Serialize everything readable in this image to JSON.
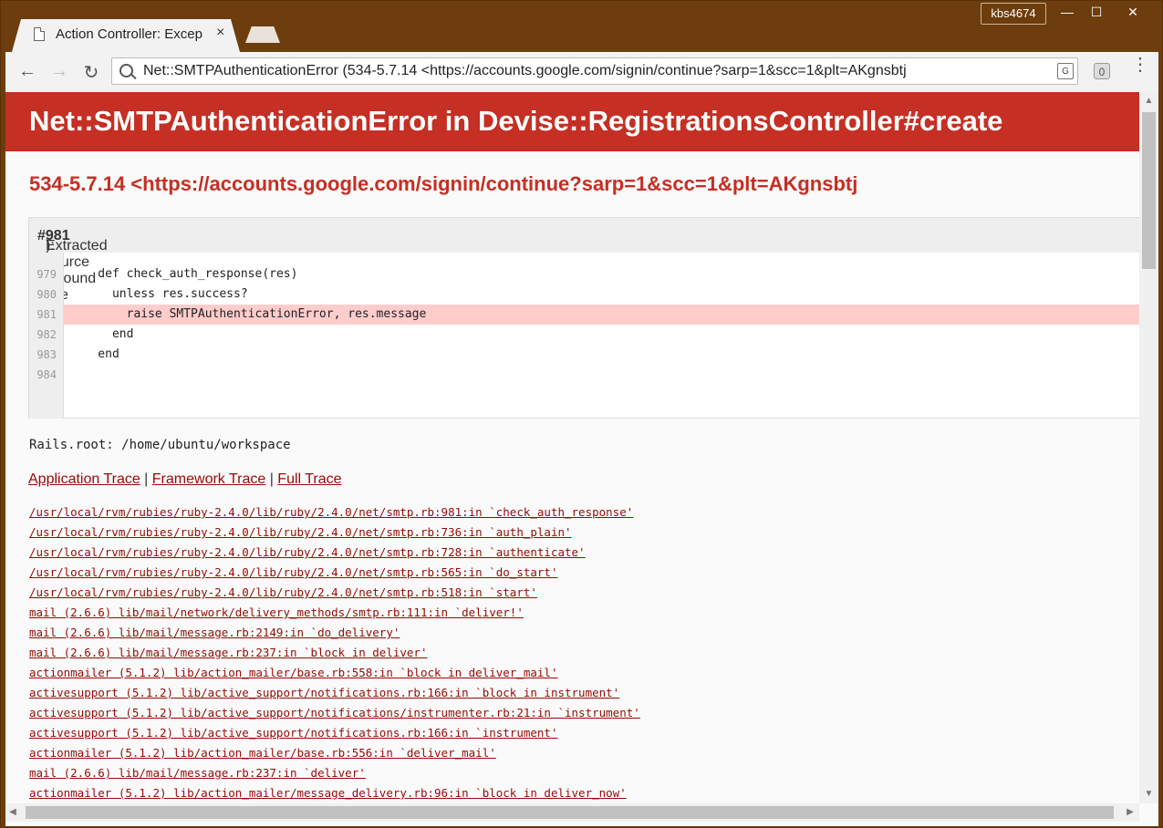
{
  "window": {
    "tab_title": "Action Controller: Excep",
    "tab_close": "×",
    "profile": "kbs4674",
    "minimize": "—",
    "maximize": "☐",
    "close": "✕"
  },
  "toolbar": {
    "back": "←",
    "forward": "→",
    "reload": "↻",
    "url": "Net::SMTPAuthenticationError (534-5.7.14 <https://accounts.google.com/signin/continue?sarp=1&scc=1&plt=AKgnsbtj",
    "translate": "G",
    "extension_badge": "0",
    "menu": "⋮"
  },
  "page": {
    "title": "Net::SMTPAuthenticationError in Devise::RegistrationsController#create",
    "message": "534-5.7.14 <https://accounts.google.com/signin/continue?sarp=1&scc=1&plt=AKgnsbtj",
    "source_header_prefix": "Extracted source (around line ",
    "source_header_line": "#981",
    "source_header_suffix": "):",
    "source_lines": [
      {
        "no": "979",
        "code": "    def check_auth_response(res)"
      },
      {
        "no": "980",
        "code": "      unless res.success?"
      },
      {
        "no": "981",
        "code": "        raise SMTPAuthenticationError, res.message"
      },
      {
        "no": "982",
        "code": "      end"
      },
      {
        "no": "983",
        "code": "    end"
      },
      {
        "no": "984",
        "code": ""
      }
    ],
    "rails_root": "Rails.root: /home/ubuntu/workspace",
    "trace_links": {
      "application": "Application Trace",
      "framework": "Framework Trace",
      "full": "Full Trace",
      "sep": " | "
    },
    "trace": [
      "/usr/local/rvm/rubies/ruby-2.4.0/lib/ruby/2.4.0/net/smtp.rb:981:in `check_auth_response'",
      "/usr/local/rvm/rubies/ruby-2.4.0/lib/ruby/2.4.0/net/smtp.rb:736:in `auth_plain'",
      "/usr/local/rvm/rubies/ruby-2.4.0/lib/ruby/2.4.0/net/smtp.rb:728:in `authenticate'",
      "/usr/local/rvm/rubies/ruby-2.4.0/lib/ruby/2.4.0/net/smtp.rb:565:in `do_start'",
      "/usr/local/rvm/rubies/ruby-2.4.0/lib/ruby/2.4.0/net/smtp.rb:518:in `start'",
      "mail (2.6.6) lib/mail/network/delivery_methods/smtp.rb:111:in `deliver!'",
      "mail (2.6.6) lib/mail/message.rb:2149:in `do_delivery'",
      "mail (2.6.6) lib/mail/message.rb:237:in `block in deliver'",
      "actionmailer (5.1.2) lib/action_mailer/base.rb:558:in `block in deliver_mail'",
      "activesupport (5.1.2) lib/active_support/notifications.rb:166:in `block in instrument'",
      "activesupport (5.1.2) lib/active_support/notifications/instrumenter.rb:21:in `instrument'",
      "activesupport (5.1.2) lib/active_support/notifications.rb:166:in `instrument'",
      "actionmailer (5.1.2) lib/action_mailer/base.rb:556:in `deliver_mail'",
      "mail (2.6.6) lib/mail/message.rb:237:in `deliver'",
      "actionmailer (5.1.2) lib/action_mailer/message_delivery.rb:96:in `block in deliver_now'"
    ]
  },
  "colors": {
    "header_red": "#c52f24",
    "link_red": "#980905",
    "highlight": "#ffcccc",
    "frame_brown": "#6d3d0d"
  }
}
